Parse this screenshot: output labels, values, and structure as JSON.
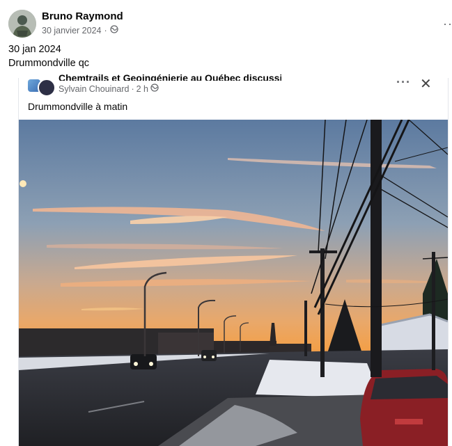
{
  "post": {
    "author": "Bruno Raymond",
    "date": "30 janvier 2024",
    "audience_icon": "globe-icon",
    "text_line1": "30 jan 2024",
    "text_line2": "Drummondville qc"
  },
  "shared_post": {
    "group_name": "Chemtrails et Geoingénierie au Québec discussion",
    "author": "Sylvain Chouinard",
    "time": "2 h",
    "audience_icon": "globe-icon",
    "caption": "Drummondville à matin"
  },
  "colors": {
    "meta_gray": "#65676b",
    "text_dark": "#050505"
  }
}
